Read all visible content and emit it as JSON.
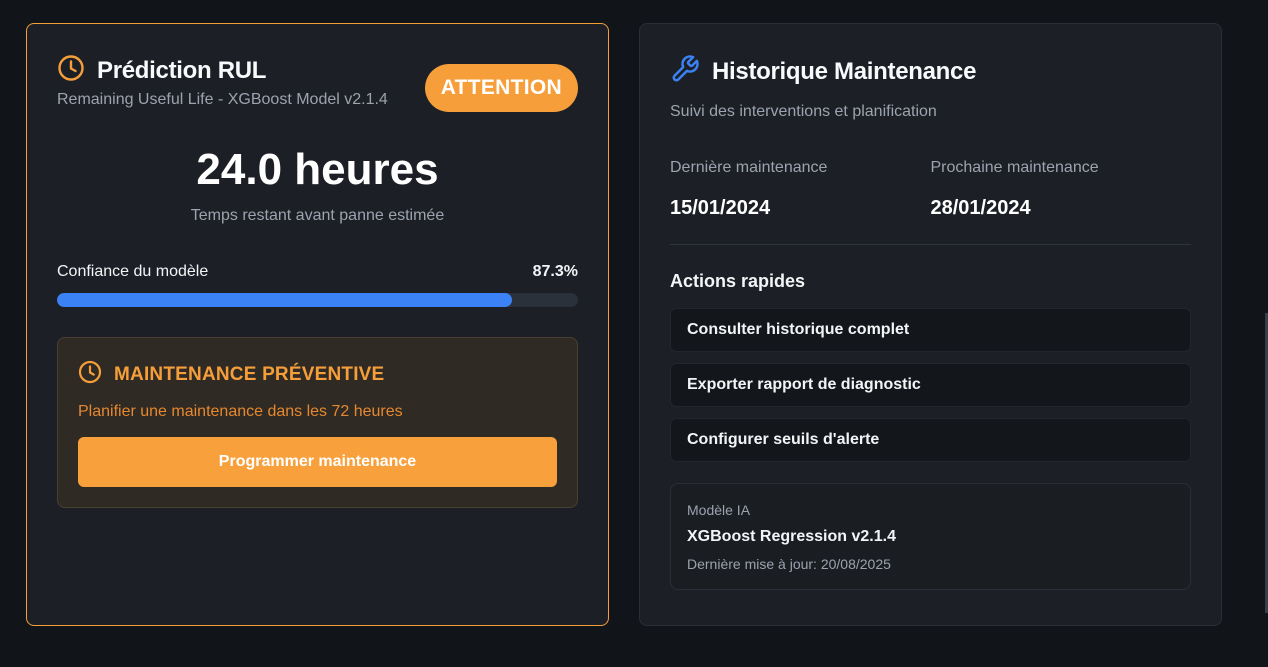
{
  "colors": {
    "accent_orange": "#f59e3a",
    "accent_blue": "#3b82f6",
    "background": "#111418",
    "card": "#1c2026"
  },
  "rul_card": {
    "icon": "clock-icon",
    "title": "Prédiction RUL",
    "subtitle": "Remaining Useful Life - XGBoost Model v2.1.4",
    "badge": "ATTENTION",
    "value": "24.0 heures",
    "caption": "Temps restant avant panne estimée",
    "confidence_label": "Confiance du modèle",
    "confidence_value": "87.3%",
    "confidence_fraction": 0.873,
    "preventive": {
      "icon": "clock-icon",
      "title": "MAINTENANCE PRÉVENTIVE",
      "text": "Planifier une maintenance dans les 72 heures",
      "button": "Programmer maintenance"
    }
  },
  "maintenance_card": {
    "icon": "wrench-icon",
    "title": "Historique Maintenance",
    "subtitle": "Suivi des interventions et planification",
    "last_label": "Dernière maintenance",
    "last_value": "15/01/2024",
    "next_label": "Prochaine maintenance",
    "next_value": "28/01/2024",
    "actions_title": "Actions rapides",
    "actions": [
      "Consulter historique complet",
      "Exporter rapport de diagnostic",
      "Configurer seuils d'alerte"
    ],
    "model": {
      "label": "Modèle IA",
      "name": "XGBoost Regression v2.1.4",
      "updated": "Dernière mise à jour: 20/08/2025"
    }
  }
}
